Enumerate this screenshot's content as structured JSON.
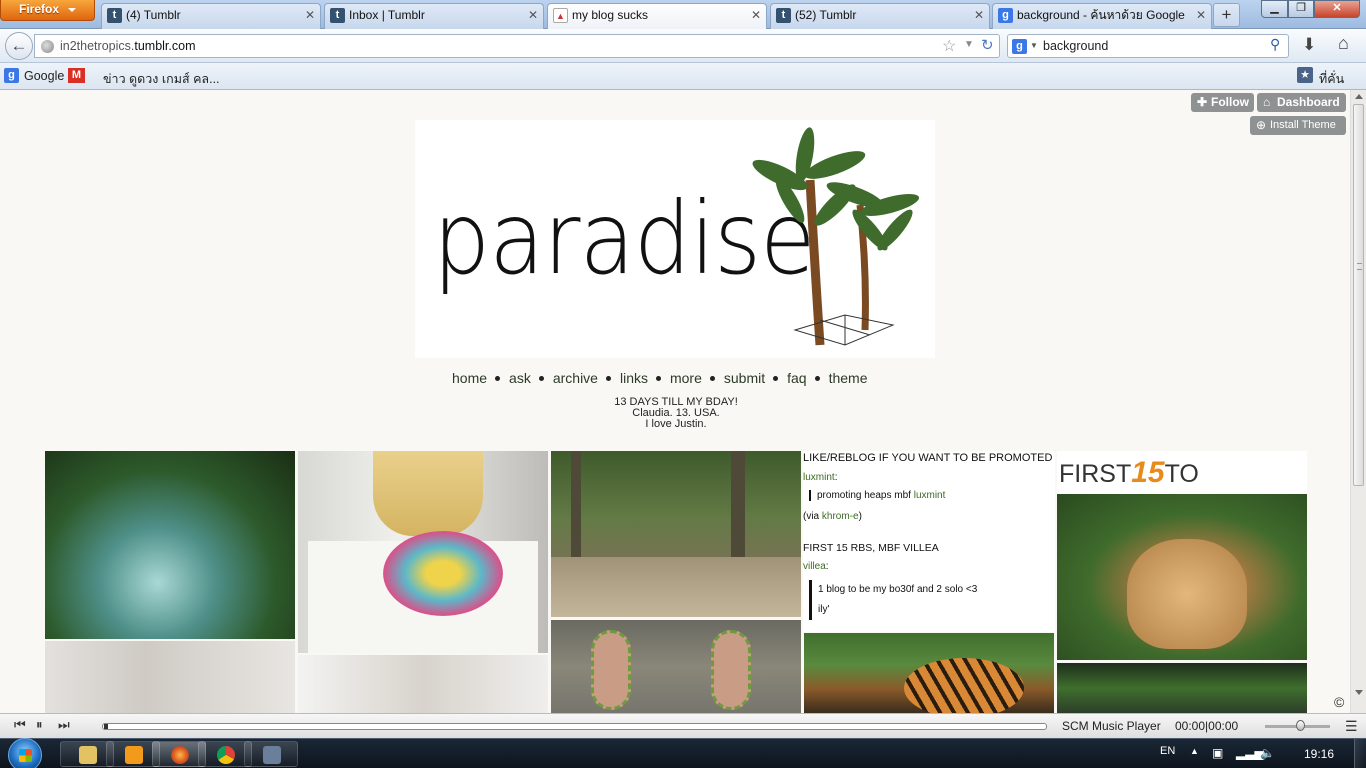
{
  "browser": {
    "menu_button": "Firefox",
    "tabs": [
      {
        "label": "(4) Tumblr",
        "icon": "tumblr-icon"
      },
      {
        "label": "Inbox | Tumblr",
        "icon": "tumblr-icon"
      },
      {
        "label": "my blog sucks",
        "icon": "blog-favicon-icon",
        "active": true
      },
      {
        "label": "(52) Tumblr",
        "icon": "tumblr-icon"
      },
      {
        "label": "background - ค้นหาด้วย Google",
        "icon": "google-icon"
      }
    ],
    "url_host": "in2thetropics.",
    "url_domain": "tumblr.com",
    "search_value": "background",
    "bookmarks": {
      "google": "Google",
      "thai": "ข่าว ดูดวง เกมส์ คล...",
      "home": "ที่คั่นหน้า"
    }
  },
  "blog": {
    "buttons": {
      "follow": "Follow",
      "dashboard": "Dashboard",
      "install": "Install Theme"
    },
    "header_title": "paradise",
    "nav": [
      "home",
      "ask",
      "archive",
      "links",
      "more",
      "submit",
      "faq",
      "theme"
    ],
    "desc": {
      "line1": "13 DAYS TILL MY BDAY!",
      "line2": "Claudia. 13. USA.",
      "line3": "I love Justin."
    },
    "promo": {
      "title1": "LIKE/REBLOG IF YOU WANT TO BE PROMOTED",
      "user1": "luxmint",
      "colon1": ":",
      "quote1_text": "promoting heaps mbf ",
      "quote1_link": "luxmint",
      "via_prefix": "(via ",
      "via_user": "khrom-e",
      "via_suffix": ")",
      "title2": "FIRST 15 RBS, MBF VILLEA",
      "user2": "villea",
      "colon2": ":",
      "quote2_line1": "1 blog to be my bo30f and 2 solo <3",
      "quote2_line2": "ily'"
    },
    "first15": {
      "left": "FIRST",
      "num": "15",
      "right": "TO REBLOG"
    },
    "copyright_symbol": "©"
  },
  "player": {
    "title": "SCM Music Player",
    "time": "00:00|00:00"
  },
  "taskbar": {
    "lang": "EN",
    "time": "19:16"
  },
  "colors": {
    "link_green": "#3c6b23",
    "first15_orange": "#e98a1d",
    "page_bg": "#f9f8f5"
  }
}
